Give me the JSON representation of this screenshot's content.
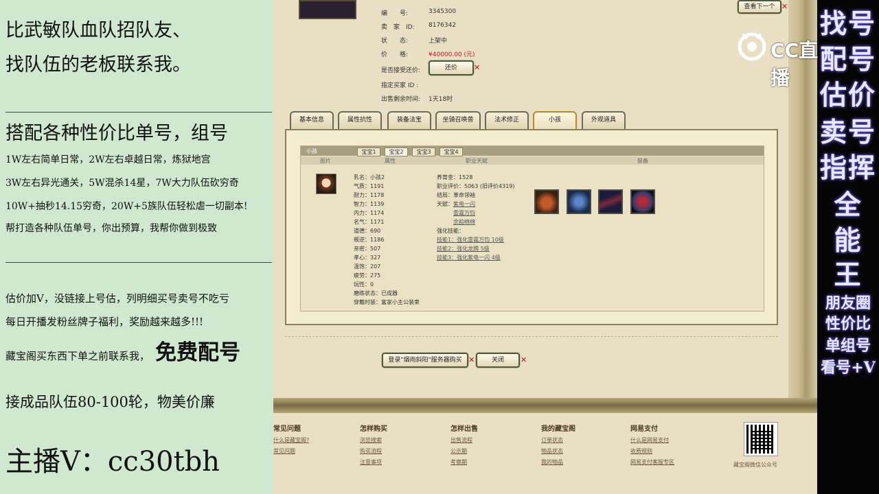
{
  "left_panel": {
    "line1": "比武敏队血队招队友、",
    "line2": "找队伍的老板联系我。",
    "line3": "搭配各种性价比单号，组号",
    "line4": "1W左右简单日常，2W左右卓越日常，炼狱地宫",
    "line5": "3W左右异光通关，5W混杀14星，7W大力队伍砍穷奇",
    "line6": "10W+抽秒14.15穷奇，20W+5族队伍轻松虐一切副本!",
    "line7": "帮打造各种队伍单号，你出预算，我帮你做到极致",
    "line8": "估价加V，没链接上号估，列明细买号卖号不吃亏",
    "line9": "每日开播发粉丝牌子福利，奖励越来越多!!!",
    "line10a": "藏宝阁买东西下单之前联系我，",
    "line10b": "免费配号",
    "line11": "接成品队伍80-100轮，物美价廉",
    "line12": "主播V：cc30tbh"
  },
  "right_strip": {
    "r1": "找号",
    "r2": "配号",
    "r3": "估价",
    "r4": "卖号",
    "r5": "指挥",
    "r6": "全",
    "r7": "能",
    "r8": "王",
    "s1": "朋友圈",
    "s2": "性价比",
    "s3": "单组号",
    "s4": "看号+V"
  },
  "logo": {
    "text": "CC直播"
  },
  "listing": {
    "id_label": "编　　号:",
    "id_value": "3345300",
    "seller_label": "卖　家　ID:",
    "seller_value": "8176342",
    "status_label": "状　　态:",
    "status_value": "上架中",
    "price_label": "价　　格:",
    "price_value": "¥40000.00 (元)",
    "bargain_label": "是否接受还价:",
    "bargain_button": "还价",
    "buyer_label": "指定买家 ID :",
    "time_label": "出售剩余时间:",
    "time_value": "1天18时",
    "next_button": "查看下一个"
  },
  "tabs": [
    "基本信息",
    "属性抗性",
    "装备法宝",
    "坐骑召唤兽",
    "法术修正",
    "小孩",
    "外观道具"
  ],
  "child_panel": {
    "title": "小孩",
    "child_tabs": [
      "宝宝1",
      "宝宝2",
      "宝宝3",
      "宝宝4"
    ],
    "col_image": "图片",
    "col_attr": "属性",
    "col_career": "职业天赋",
    "col_equip": "装备",
    "attrs": [
      "乳名：小孩2",
      "气质：1191",
      "耐力：1178",
      "智力：1139",
      "内力：1174",
      "名气：1171",
      "道德：690",
      "叛逆：1186",
      "亲密：507",
      "孝心：327",
      "温饱：207",
      "疲劳：275",
      "玩性：0",
      "磨练状态：已成器",
      "穿戴时装：富家小主公装束"
    ],
    "career": {
      "fee": "养育金：1528",
      "score": "职业评价：5063 (旧评价4319)",
      "ending": "结局：革命领袖",
      "talent_label": "天赋：",
      "talents": [
        "紫电一闪",
        "雷霆万钧",
        "余韵绵绵"
      ],
      "skill_label": "强化技能：",
      "skills": [
        "技能1：强化雷霆万钧 10级",
        "技能2：强化龙腾 5级",
        "技能3：强化紫电一闪 4级"
      ]
    }
  },
  "actions": {
    "login_button": "登录\"烟雨斜阳\"服务器购买",
    "close_button": "关闭"
  },
  "footer": {
    "headings": [
      "常见问题",
      "怎样购买",
      "怎样出售",
      "我的藏宝阁",
      "网易支付"
    ],
    "col1": [
      "什么是藏宝阁?",
      "常见问题"
    ],
    "col2": [
      "浏览搜索",
      "购买流程",
      "注意事项"
    ],
    "col3": [
      "出售流程",
      "公示期",
      "考察期"
    ],
    "col4": [
      "订单状态",
      "物品状态",
      "我的物品"
    ],
    "col5": [
      "什么是网易支付",
      "收费规则",
      "网易支付客服专区"
    ],
    "qr_caption": "藏宝阁微信公众号"
  }
}
